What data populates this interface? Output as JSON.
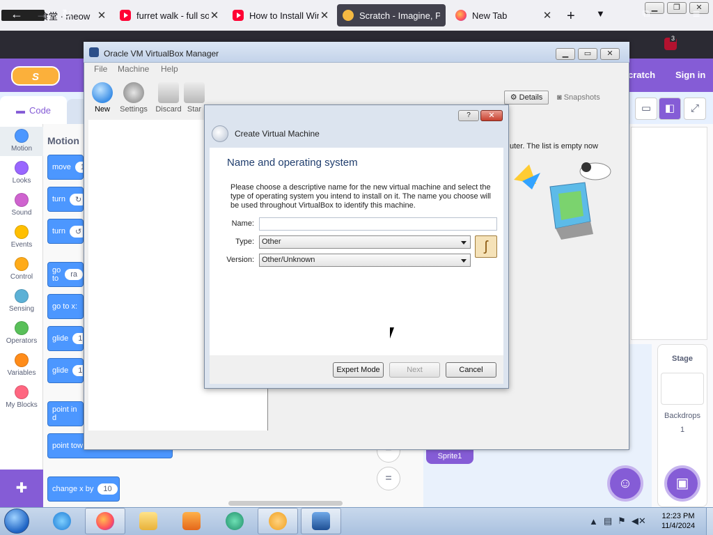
{
  "browser": {
    "tabs": [
      {
        "title": "快乐大食堂 · meow",
        "icon": "cat-favicon"
      },
      {
        "title": "furret walk - full so",
        "icon": "youtube-favicon"
      },
      {
        "title": "How to Install Wind",
        "icon": "youtube-favicon"
      },
      {
        "title": "Scratch - Imagine, P",
        "icon": "scratch-favicon",
        "active": true
      },
      {
        "title": "New Tab",
        "icon": "firefox-favicon"
      }
    ],
    "extension_badge": "3"
  },
  "scratch": {
    "create_link": "cratch",
    "signin_link": "Sign in",
    "code_tab": "Code",
    "categories": [
      {
        "label": "Motion",
        "color": "#4c97ff"
      },
      {
        "label": "Looks",
        "color": "#9966ff"
      },
      {
        "label": "Sound",
        "color": "#cf63cf"
      },
      {
        "label": "Events",
        "color": "#ffbf00"
      },
      {
        "label": "Control",
        "color": "#ffab19"
      },
      {
        "label": "Sensing",
        "color": "#5cb1d6"
      },
      {
        "label": "Operators",
        "color": "#59c059"
      },
      {
        "label": "Variables",
        "color": "#ff8c1a"
      },
      {
        "label": "My Blocks",
        "color": "#ff6680"
      }
    ],
    "palette_title": "Motion",
    "blocks": [
      {
        "label": "move",
        "value": "1"
      },
      {
        "label": "turn",
        "value": "↻"
      },
      {
        "label": "turn",
        "value": "↺"
      },
      {
        "label": "go to",
        "value": "ra"
      },
      {
        "label": "go to x:",
        "value": ""
      },
      {
        "label": "glide",
        "value": "1"
      },
      {
        "label": "glide",
        "value": "1"
      },
      {
        "label": "point in d",
        "value": ""
      },
      {
        "label": "point tow",
        "value": ""
      },
      {
        "label": "change x by",
        "value": "10"
      }
    ],
    "zoom_reset": "=",
    "sprite_name": "Sprite1",
    "stage_label": "Stage",
    "backdrops_label": "Backdrops",
    "backdrops_count": "1"
  },
  "vbox": {
    "title": "Oracle VM VirtualBox Manager",
    "menu": [
      "File",
      "Machine",
      "Help"
    ],
    "toolbar": [
      {
        "label": "New",
        "icon": "new-vm-icon"
      },
      {
        "label": "Settings",
        "icon": "settings-gear-icon"
      },
      {
        "label": "Discard",
        "icon": "discard-arrow-icon"
      },
      {
        "label": "Star",
        "icon": "start-arrow-icon"
      }
    ],
    "details_label": "Details",
    "snapshots_label": "Snapshots",
    "welcome_text": "uter. The list is empty now"
  },
  "dialog": {
    "caption": "Create Virtual Machine",
    "heading": "Name and operating system",
    "description": "Please choose a descriptive name for the new virtual machine and select the type of operating system you intend to install on it. The name you choose will be used throughout VirtualBox to identify this machine.",
    "name_label": "Name:",
    "name_value": "",
    "type_label": "Type:",
    "type_value": "Other",
    "version_label": "Version:",
    "version_value": "Other/Unknown",
    "expert_button": "Expert Mode",
    "next_button": "Next",
    "cancel_button": "Cancel",
    "help_button": "?",
    "close_button": "✕"
  },
  "taskbar": {
    "time": "12:23 PM",
    "date": "11/4/2024"
  }
}
